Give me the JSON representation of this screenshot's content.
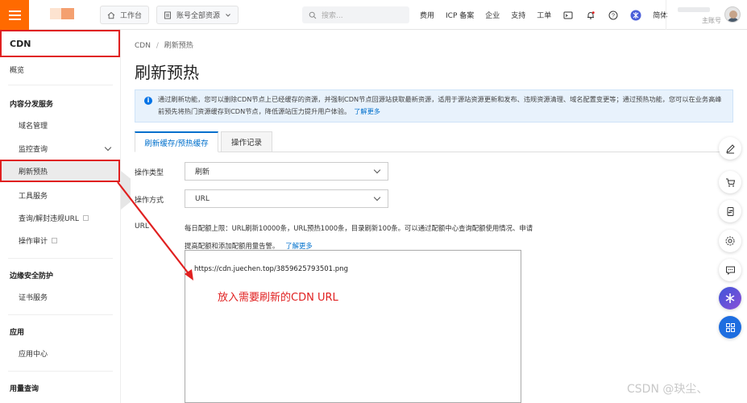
{
  "header": {
    "workbench": "工作台",
    "resources": "账号全部资源",
    "search_placeholder": "搜索...",
    "links": [
      "费用",
      "ICP 备案",
      "企业",
      "支持",
      "工单"
    ],
    "lang": "简体",
    "account_sub": "主账号"
  },
  "sidebar": {
    "title": "CDN",
    "overview": "概览",
    "groups": {
      "content": "内容分发服务",
      "edge": "边缘安全防护",
      "apps": "应用",
      "usage": "用量查询"
    },
    "items": {
      "domain": "域名管理",
      "monitor": "监控查询",
      "refresh": "刷新预热",
      "tools": "工具服务",
      "query_url": "查询/解封违规URL",
      "audit": "操作审计",
      "cert": "证书服务",
      "app_center": "应用中心"
    }
  },
  "main": {
    "breadcrumb": [
      "CDN",
      "/",
      "刷新预热"
    ],
    "title": "刷新预热",
    "info": {
      "text": "通过刷新功能，您可以删除CDN节点上已经缓存的资源，并强制CDN节点回源站获取最新资源，适用于源站资源更新和发布、违规资源清理、域名配置变更等；通过预热功能，您可以在业务高峰前预先将热门资源缓存到CDN节点，降低源站压力提升用户体验。",
      "link": "了解更多"
    },
    "tabs": [
      "刷新缓存/预热缓存",
      "操作记录"
    ],
    "form": {
      "op_type_label": "操作类型",
      "op_type_value": "刷新",
      "op_mode_label": "操作方式",
      "op_mode_value": "URL",
      "url_label": "URL",
      "hint": "每日配额上限：URL刷新10000条，URL预热1000条，目录刷新100条。可以通过配额中心查询配额使用情况、申请提高配额和添加配额用量告警。",
      "hint_link": "了解更多",
      "url_value": "https://cdn.juechen.top/3859625793501.png"
    },
    "annotation": "放入需要刷新的CDN URL"
  },
  "watermark": "CSDN @玦尘、",
  "colors": {
    "accent": "#ff6a00",
    "link": "#0070cc",
    "highlight": "#e02020"
  }
}
